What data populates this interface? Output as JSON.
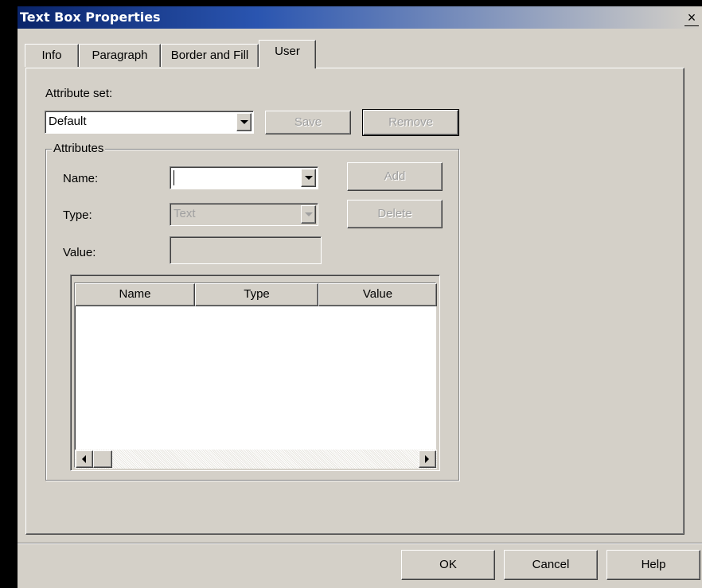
{
  "window": {
    "title": "Text Box Properties",
    "close_glyph": "×"
  },
  "tabs": [
    {
      "label": "Info"
    },
    {
      "label": "Paragraph"
    },
    {
      "label": "Border and Fill"
    },
    {
      "label": "User",
      "active": true
    }
  ],
  "attribute_set": {
    "label": "Attribute set:",
    "value": "Default",
    "save_label": "Save",
    "remove_label": "Remove"
  },
  "attributes": {
    "legend": "Attributes",
    "name_label": "Name:",
    "name_value": "",
    "type_label": "Type:",
    "type_value": "Text",
    "value_label": "Value:",
    "value_value": "",
    "add_label": "Add",
    "delete_label": "Delete",
    "columns": [
      "Name",
      "Type",
      "Value"
    ],
    "rows": []
  },
  "footer": {
    "ok_label": "OK",
    "cancel_label": "Cancel",
    "help_label": "Help"
  },
  "colors": {
    "face": "#d4d0c8",
    "title_bar": "#0a246a",
    "disabled_text": "#a0a0a0"
  },
  "icons": {
    "dropdown": "chevron-down-icon",
    "scroll_left": "arrow-left-icon",
    "scroll_right": "arrow-right-icon"
  }
}
